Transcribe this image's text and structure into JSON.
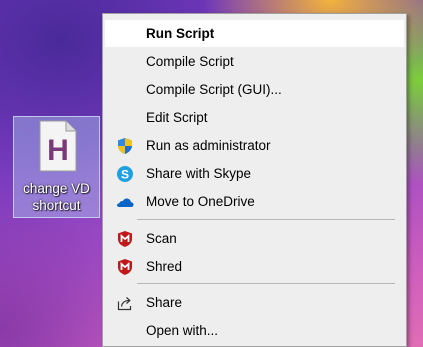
{
  "desktop_icon": {
    "label_line1": "change VD",
    "label_line2": "shortcut",
    "glyph_letter": "H",
    "icon": "script-file-icon"
  },
  "context_menu": {
    "items": [
      {
        "label": "Run Script",
        "icon": null,
        "bold": true,
        "highlighted": true
      },
      {
        "label": "Compile Script",
        "icon": null
      },
      {
        "label": "Compile Script (GUI)...",
        "icon": null
      },
      {
        "label": "Edit Script",
        "icon": null
      },
      {
        "label": "Run as administrator",
        "icon": "uac-shield-icon"
      },
      {
        "label": "Share with Skype",
        "icon": "skype-icon"
      },
      {
        "label": "Move to OneDrive",
        "icon": "onedrive-cloud-icon"
      },
      {
        "label": "Scan",
        "icon": "mcafee-icon"
      },
      {
        "label": "Shred",
        "icon": "mcafee-icon"
      },
      {
        "label": "Share",
        "icon": "share-icon"
      },
      {
        "label": "Open with...",
        "icon": null
      }
    ]
  },
  "colors": {
    "menu_background": "#eeeeee",
    "highlight": "#ffffff",
    "mcafee_red": "#c01818",
    "skype_blue": "#1fa0e0",
    "onedrive_blue": "#0a64c8",
    "file_icon_purple": "#7a3a7a"
  }
}
